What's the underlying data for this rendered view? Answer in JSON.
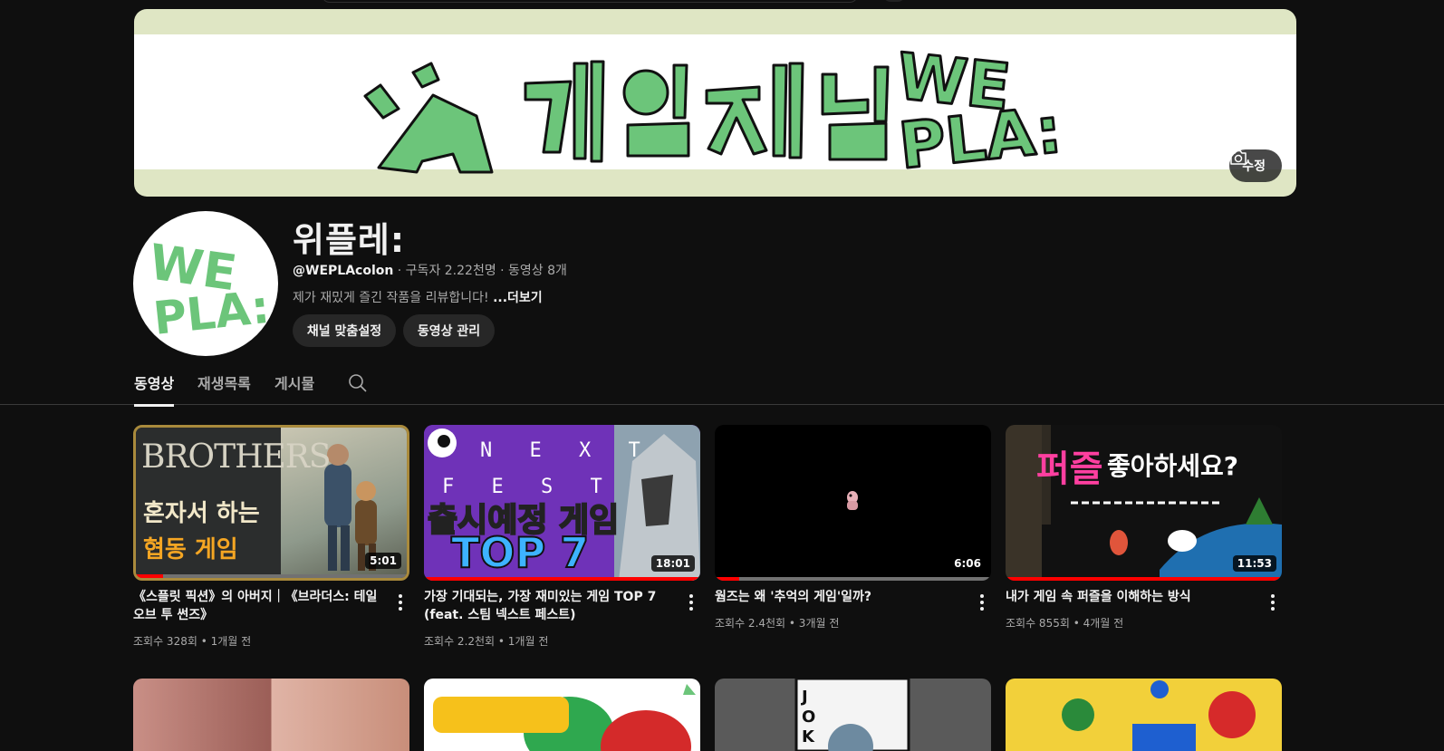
{
  "banner": {
    "edit_label": "수정",
    "colors": {
      "green": "#6cc57a",
      "bg": "#dfe6c4"
    }
  },
  "channel": {
    "name": "위플레:",
    "handle": "@WEPLAcolon",
    "stats": " · 구독자 2.22천명 · 동영상 8개",
    "description": "제가 재밌게 즐긴 작품을 리뷰합니다! ",
    "more": "...더보기",
    "customize_label": "채널 맞춤설정",
    "manage_label": "동영상 관리"
  },
  "tabs": [
    {
      "label": "동영상"
    },
    {
      "label": "재생목록"
    },
    {
      "label": "게시물"
    }
  ],
  "videos": [
    {
      "title": "《스플릿 픽션》의 아버지｜《브라더스: 테일 오브 투 썬즈》",
      "meta": "조회수 328회 • 1개월 전",
      "duration": "5:01",
      "progress": 0.1,
      "thumb_text": [
        "BROTHERS",
        "혼자서 하는",
        "협동 게임"
      ]
    },
    {
      "title": "가장 기대되는, 가장 재미있는 게임 TOP 7 (feat. 스팀 넥스트 페스트)",
      "meta": "조회수 2.2천회 • 1개월 전",
      "duration": "18:01",
      "progress": 1.0,
      "thumb_text": [
        "N E X T",
        "F E S T",
        "출시예정 게임",
        "TOP 7"
      ]
    },
    {
      "title": "웜즈는 왜 '추억의 게임'일까?",
      "meta": "조회수 2.4천회 • 3개월 전",
      "duration": "6:06",
      "progress": 0.09
    },
    {
      "title": "내가 게임 속 퍼즐을 이해하는 방식",
      "meta": "조회수 855회 • 4개월 전",
      "duration": "11:53",
      "progress": 1.0,
      "thumb_text": [
        "퍼즐",
        "좋아하세요?"
      ]
    }
  ]
}
